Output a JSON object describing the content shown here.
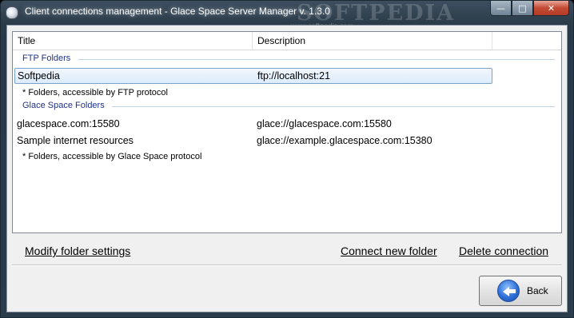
{
  "window": {
    "title": "Client connections management - Glace Space Server Manager v. 1.3.0",
    "watermark": "SOFTPEDIA",
    "watermark_url": "www.softpedia.com"
  },
  "list": {
    "columns": [
      "Title",
      "Description"
    ],
    "groups": [
      {
        "name": "FTP Folders",
        "rows": [
          {
            "title": "Softpedia",
            "description": "ftp://localhost:21",
            "selected": true
          }
        ],
        "note": "* Folders, accessible by FTP protocol"
      },
      {
        "name": "Glace Space Folders",
        "rows": [
          {
            "title": "glacespace.com:15580",
            "description": "glace://glacespace.com:15580",
            "selected": false
          },
          {
            "title": "Sample internet resources",
            "description": "glace://example.glacespace.com:15380",
            "selected": false
          }
        ],
        "note": "* Folders, accessible by Glace Space protocol"
      }
    ]
  },
  "actions": {
    "modify": "Modify folder settings",
    "connect": "Connect new folder",
    "delete": "Delete connection"
  },
  "back_button": {
    "label": "Back",
    "icon": "back-arrow-icon"
  }
}
